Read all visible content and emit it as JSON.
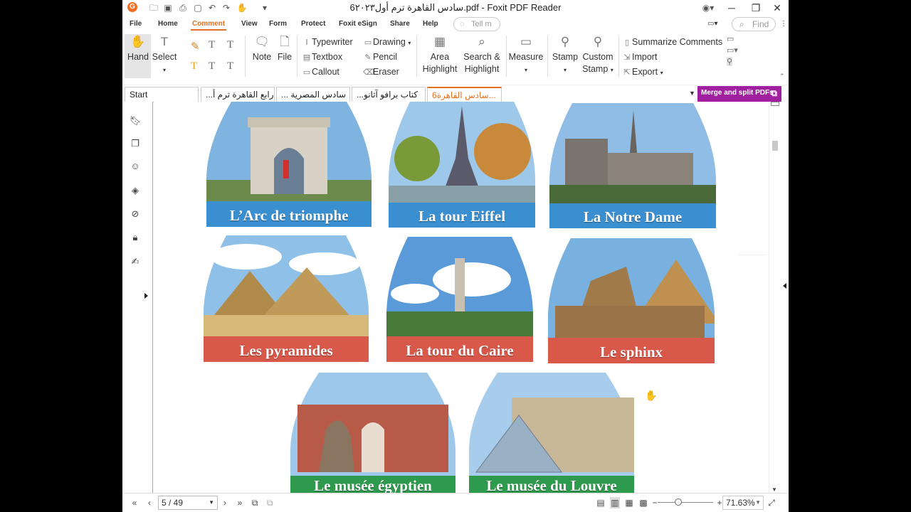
{
  "window": {
    "title": "6سادس القاهرة ترم أول٢٠٢٣.pdf - Foxit PDF Reader",
    "minimize_icon": "minimize-icon",
    "restore_icon": "restore-icon",
    "close_icon": "close-icon"
  },
  "menu": [
    "File",
    "Home",
    "Comment",
    "View",
    "Form",
    "Protect",
    "Foxit eSign",
    "Share",
    "Help"
  ],
  "active_menu": "Comment",
  "tell_me": "Tell m",
  "find": "Find",
  "ribbon": {
    "hand": "Hand",
    "select": "Select",
    "note": "Note",
    "file": "File",
    "typewriter": "Typewriter",
    "textbox": "Textbox",
    "callout": "Callout",
    "drawing": "Drawing",
    "pencil": "Pencil",
    "eraser": "Eraser",
    "area_highlight_1": "Area",
    "area_highlight_2": "Highlight",
    "search_highlight_1": "Search &",
    "search_highlight_2": "Highlight",
    "measure": "Measure",
    "stamp": "Stamp",
    "custom_stamp_1": "Custom",
    "custom_stamp_2": "Stamp",
    "summarize_comments": "Summarize Comments",
    "import": "Import",
    "export": "Export"
  },
  "tabs": [
    {
      "label": "Start",
      "active": false
    },
    {
      "label": "...رابع القاهرة ترم أ",
      "active": false
    },
    {
      "label": "... سادس المصرية",
      "active": false
    },
    {
      "label": "...كتاب برافو آثانو",
      "active": false
    },
    {
      "label": "6سادس القاهرة...",
      "active": true
    }
  ],
  "merge_button": "Merge and split PDFs",
  "document": {
    "landmarks": [
      {
        "caption": "L’Arc de triomphe",
        "band_color": "#3a8fd0"
      },
      {
        "caption": "La tour Eiffel",
        "band_color": "#3a8fd0"
      },
      {
        "caption": "La Notre Dame",
        "band_color": "#3a8fd0"
      },
      {
        "caption": "Les pyramides",
        "band_color": "#d8584a"
      },
      {
        "caption": "La tour du Caire",
        "band_color": "#d8584a"
      },
      {
        "caption": "Le sphinx",
        "band_color": "#d8584a"
      },
      {
        "caption": "Le musée égyptien",
        "band_color": "#2e9a4e"
      },
      {
        "caption": "Le musée du Louvre",
        "band_color": "#2e9a4e"
      }
    ]
  },
  "status": {
    "page": "5 / 49",
    "zoom": "71.63%"
  }
}
